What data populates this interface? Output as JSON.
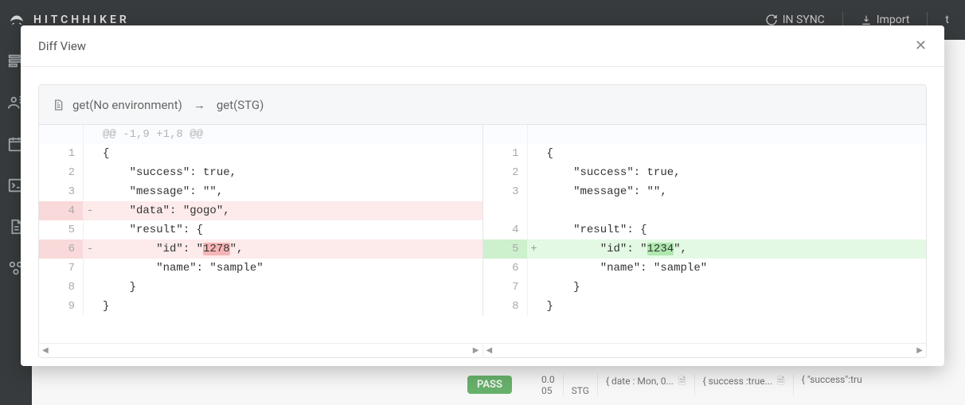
{
  "topbar": {
    "brand": "HITCHHIKER",
    "sync": "IN SYNC",
    "import": "Import",
    "extra": "t"
  },
  "modal": {
    "title": "Diff View",
    "caption_left": "get(No environment)",
    "caption_right": "get(STG)",
    "hunk": "@@ -1,9 +1,8 @@"
  },
  "left_rows": [
    {
      "num": "",
      "sign": "",
      "text": "@@ -1,9 +1,8 @@",
      "cls": "hunk"
    },
    {
      "num": "1",
      "sign": "",
      "text": "{"
    },
    {
      "num": "2",
      "sign": "",
      "text": "    \"success\": true,"
    },
    {
      "num": "3",
      "sign": "",
      "text": "    \"message\": \"\","
    },
    {
      "num": "4",
      "sign": "-",
      "text": "    \"data\": \"gogo\",",
      "cls": "minus"
    },
    {
      "num": "5",
      "sign": "",
      "text": "    \"result\": {"
    },
    {
      "num": "6",
      "sign": "-",
      "text": "        \"id\": \"",
      "tail": "\",",
      "hl": "1278",
      "cls": "minus"
    },
    {
      "num": "7",
      "sign": "",
      "text": "        \"name\": \"sample\""
    },
    {
      "num": "8",
      "sign": "",
      "text": "    }"
    },
    {
      "num": "9",
      "sign": "",
      "text": "}"
    }
  ],
  "right_rows": [
    {
      "num": "",
      "sign": "",
      "text": "",
      "cls": "hunk"
    },
    {
      "num": "1",
      "sign": "",
      "text": "{"
    },
    {
      "num": "2",
      "sign": "",
      "text": "    \"success\": true,"
    },
    {
      "num": "3",
      "sign": "",
      "text": "    \"message\": \"\","
    },
    {
      "num": "",
      "sign": "",
      "text": ""
    },
    {
      "num": "4",
      "sign": "",
      "text": "    \"result\": {"
    },
    {
      "num": "5",
      "sign": "+",
      "text": "        \"id\": \"",
      "tail": "\",",
      "hl": "1234",
      "cls": "plus"
    },
    {
      "num": "6",
      "sign": "",
      "text": "        \"name\": \"sample\""
    },
    {
      "num": "7",
      "sign": "",
      "text": "    }"
    },
    {
      "num": "8",
      "sign": "",
      "text": "}"
    }
  ],
  "background": {
    "pass": "PASS",
    "time1": "0.0",
    "time2": "05",
    "env": "STG",
    "c1": "{ date : Mon, 0...",
    "c2": "{ success :true...",
    "c3": "{ \"success\":tru"
  }
}
